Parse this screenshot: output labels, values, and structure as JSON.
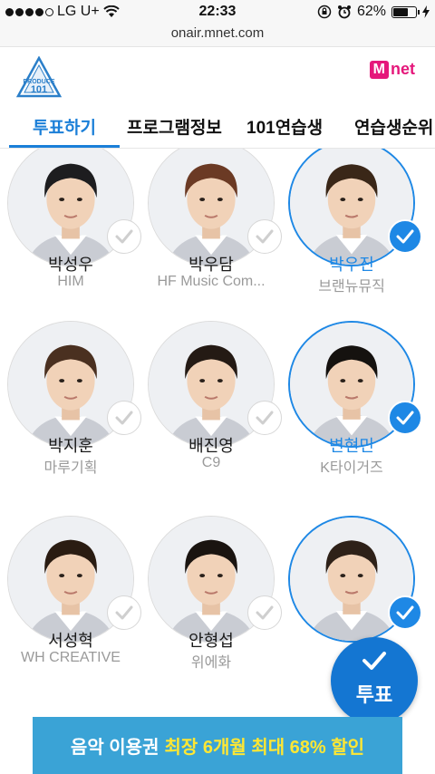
{
  "status_bar": {
    "carrier": "LG U+",
    "time": "22:33",
    "battery": "62%",
    "battery_level": 0.62,
    "signal_bars": 4,
    "icons": [
      "wifi-icon",
      "rotation-lock-icon",
      "alarm-icon",
      "battery-icon",
      "charging-icon"
    ]
  },
  "browser": {
    "url": "onair.mnet.com"
  },
  "header": {
    "logo_text_top": "PRODUCE",
    "logo_text_bottom": "101",
    "mnet_m": "M",
    "mnet_net": "net"
  },
  "tabs": [
    {
      "label": "투표하기",
      "active": true
    },
    {
      "label": "프로그램정보",
      "active": false
    },
    {
      "label": "101연습생",
      "active": false
    },
    {
      "label": "연습생순위",
      "active": false
    }
  ],
  "trainees": [
    {
      "name": "박성우",
      "agency": "HIM",
      "selected": false
    },
    {
      "name": "박우담",
      "agency": "HF Music Com...",
      "selected": false
    },
    {
      "name": "박우진",
      "agency": "브랜뉴뮤직",
      "selected": true
    },
    {
      "name": "박지훈",
      "agency": "마루기획",
      "selected": false
    },
    {
      "name": "배진영",
      "agency": "C9",
      "selected": false
    },
    {
      "name": "변현민",
      "agency": "K타이거즈",
      "selected": true
    },
    {
      "name": "서성혁",
      "agency": "WH CREATIVE",
      "selected": false
    },
    {
      "name": "안형섭",
      "agency": "위에화",
      "selected": false
    },
    {
      "name": "",
      "agency": "",
      "selected": true
    }
  ],
  "vote_button": {
    "label": "투표"
  },
  "banner": {
    "part1": "음악 이용권",
    "part2": "최장 6개월 최대 68% 할인"
  },
  "colors": {
    "accent": "#1b7fd8",
    "selected": "#1e88e5",
    "brand_mnet": "#e5187b",
    "banner_bg": "#3aa3d6",
    "banner_highlight": "#ffe733"
  }
}
